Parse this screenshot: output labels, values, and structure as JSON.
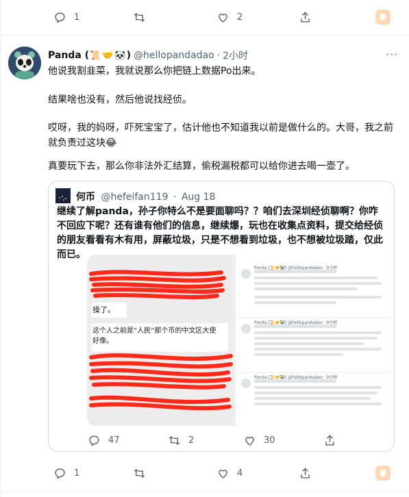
{
  "prev_tweet_actions": {
    "reply_count": "1",
    "retweet_count": "",
    "like_count": "2"
  },
  "tweet": {
    "name": "Panda (",
    "name_emoji_1": "📜",
    "name_emoji_2": "🤝",
    "name_emoji_3": "🐼",
    "name_close": ")",
    "handle": "@hellopandadao",
    "dot": "·",
    "time": "2小时",
    "more": "···",
    "paragraphs": [
      "他说我割韭菜，我就说那么你把链上数据Po出来。",
      "结果啥也没有，然后他说找经侦。",
      "哎呀，我的妈呀，吓死宝宝了，估计他也不知道我以前是做什么的。大哥，我之前就负责过这块😂",
      "真要玩下去，那么你非法外汇结算，偷税漏税都可以给你进去喝一壶了。"
    ]
  },
  "quoted": {
    "name": "何币",
    "handle": "@hefeifan119",
    "dot": "·",
    "date": "Aug 18",
    "text": "继续了解panda，孙子你特么不是要面聊吗？？咱们去深圳经侦聊啊？你咋不回应下呢？还有谁有他们的信息，继续爆，玩也在收集点资料，提交给经侦的朋友看看有木有用，屏蔽垃圾，只是不想看到垃圾，也不想被垃圾踏，仅此而已。",
    "image": {
      "left_texts": [
        "操了。",
        "这个人之前是“人民”那个币的中文区大使好像。"
      ],
      "right_posts": [
        {
          "author": "Panda (📜🤝🐼) @hellopandadao · 9小时",
          "reply": "回复 @hellopandadao"
        },
        {
          "author": "Panda (📜🤝🐼) @hellopandadao · 9小时",
          "reply": ""
        },
        {
          "author": "Panda (📜🤝🐼) @hellopandadao · 9小时",
          "reply": ""
        }
      ]
    }
  },
  "quote_actions": {
    "reply_count": "47",
    "retweet_count": "2",
    "like_count": "30"
  },
  "tweet_actions": {
    "reply_count": "1",
    "retweet_count": "",
    "like_count": "4"
  },
  "colors": {
    "text": "#0f1419",
    "secondary": "#536471",
    "border": "#cfd9de",
    "scribble": "#ff2a1a"
  }
}
